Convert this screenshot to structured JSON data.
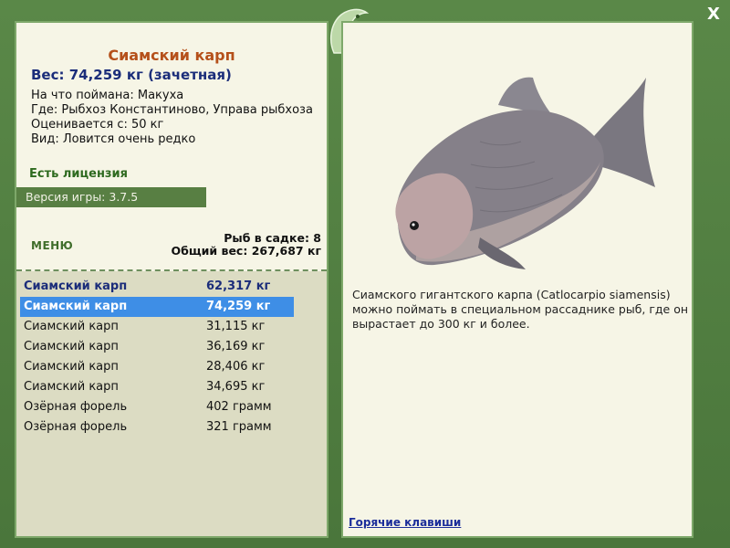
{
  "fish": {
    "title": "Сиамский карп",
    "weight": "Вес: 74,259 кг (зачетная)",
    "caught_on": "На что поймана: Макуха",
    "location": "Где: Рыбхоз Константиново, Управа рыбхоза",
    "valued_from": "Оценивается с: 50 кг",
    "rarity": "Вид: Ловится очень редко",
    "description": "Сиамского гигантского карпа (Catlocarpio siamensis) можно поймать в специальном рассаднике рыб, где он вырастает до 300 кг и более."
  },
  "license": "Есть лицензия",
  "version": "Версия игры: 3.7.5",
  "menu_label": "МЕНЮ",
  "summary": {
    "count": "Рыб в садке: 8",
    "total": "Общий вес: 267,687 кг"
  },
  "catch_list": [
    {
      "name": "Сиамский карп",
      "weight": "62,317 кг"
    },
    {
      "name": "Сиамский карп",
      "weight": "74,259 кг"
    },
    {
      "name": "Сиамский карп",
      "weight": "31,115 кг"
    },
    {
      "name": "Сиамский карп",
      "weight": "36,169 кг"
    },
    {
      "name": "Сиамский карп",
      "weight": "28,406 кг"
    },
    {
      "name": "Сиамский карп",
      "weight": "34,695 кг"
    },
    {
      "name": "Озёрная форель",
      "weight": "402 грамм"
    },
    {
      "name": "Озёрная форель",
      "weight": "321 грамм"
    }
  ],
  "hotkeys": "Горячие клавиши",
  "close_icon": "close-x-icon",
  "colors": {
    "frame": "#4f7a3f",
    "panel": "#f6f5e6",
    "title": "#b5501a",
    "selected_row": "#3e8ee6"
  }
}
